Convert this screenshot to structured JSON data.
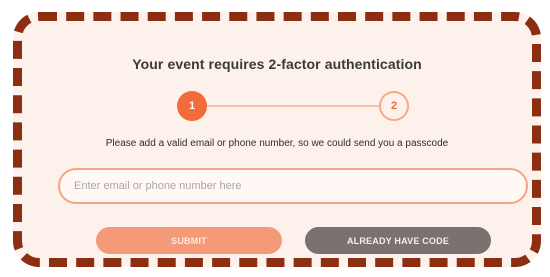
{
  "dialog": {
    "title": "Your event requires 2-factor authentication",
    "steps": [
      "1",
      "2"
    ],
    "instruction": "Please add a valid email or phone number, so we could send you a passcode",
    "input": {
      "placeholder": "Enter email or phone number here",
      "value": ""
    },
    "buttons": {
      "submit_label": "SUBMIT",
      "have_code_label": "ALREADY HAVE CODE"
    }
  },
  "colors": {
    "accent": "#f26b3a",
    "border_dashed": "#8b2e12",
    "background": "#fdf1ec",
    "submit_button": "#f49a79",
    "secondary_button": "#7a7170"
  }
}
